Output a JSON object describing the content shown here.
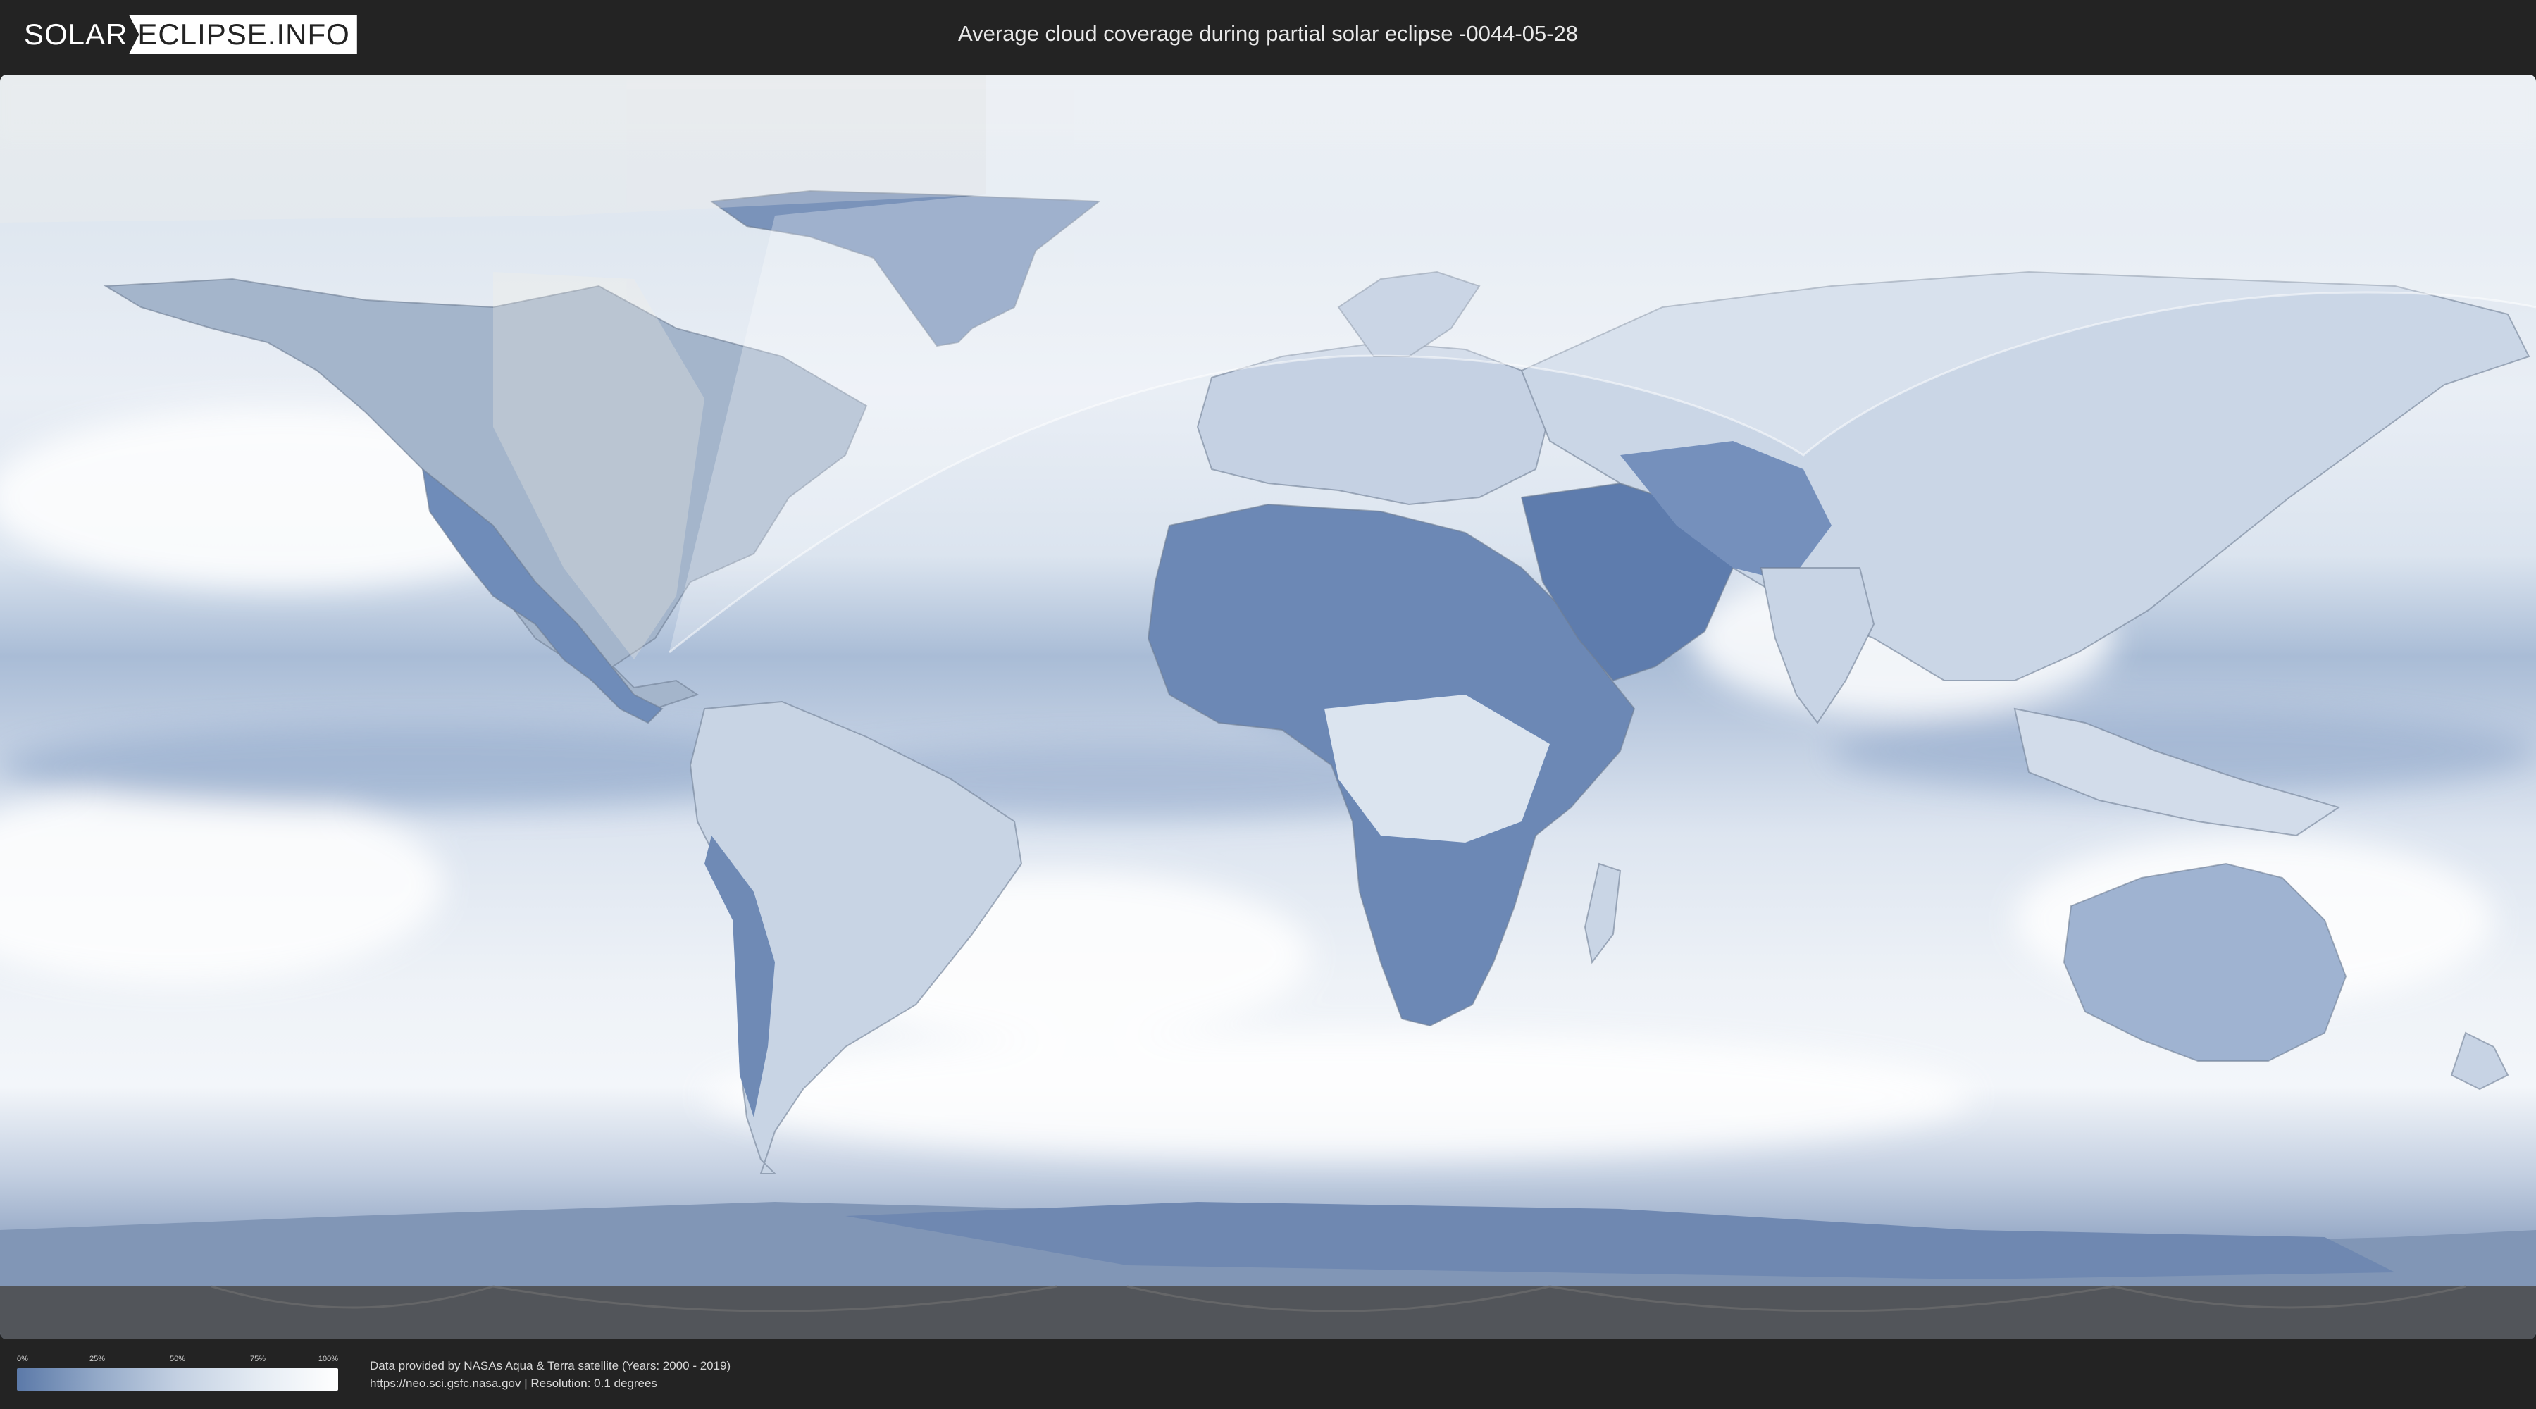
{
  "header": {
    "logo": {
      "part1": "SOLAR",
      "part2": "ECLIPSE.INFO"
    },
    "title": "Average cloud coverage during partial solar eclipse -0044-05-28"
  },
  "map": {
    "layer": "average cloud coverage",
    "projection": "equirectangular",
    "eclipse_visibility_region": "partial eclipse zone",
    "colors": {
      "clear_sky": "#5b79a8",
      "cloud_cover": "#ffffff",
      "shadow_overlay": "#000000",
      "no_data_band": "#4a4a4a"
    }
  },
  "legend": {
    "ticks": [
      {
        "label": "0%",
        "value": 0
      },
      {
        "label": "25%",
        "value": 25
      },
      {
        "label": "50%",
        "value": 50
      },
      {
        "label": "75%",
        "value": 75
      },
      {
        "label": "100%",
        "value": 100
      }
    ],
    "colors": [
      "#5b79a8",
      "#93a9c8",
      "#c3d0e2",
      "#e4ebf3",
      "#ffffff"
    ]
  },
  "credits": {
    "line1": "Data provided by NASAs Aqua & Terra satellite (Years: 2000 - 2019)",
    "line2": "https://neo.sci.gsfc.nasa.gov | Resolution: 0.1 degrees"
  }
}
